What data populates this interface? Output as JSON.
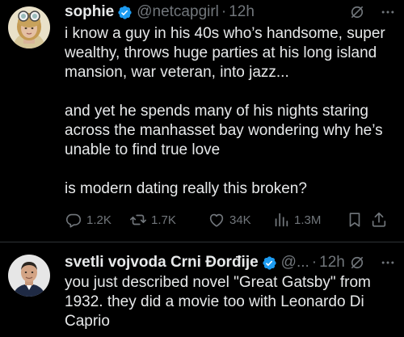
{
  "tweets": [
    {
      "display_name": "sophie",
      "handle": "@netcapgirl",
      "separator": "·",
      "time": "12h",
      "body": [
        "i know a guy in his 40s who’s handsome, super wealthy, throws huge parties at his long island mansion, war veteran, into jazz...",
        "and yet he spends many of his nights staring across the manhasset bay wondering why he’s unable to find true love",
        "is modern dating really this broken?"
      ],
      "stats": {
        "replies": "1.2K",
        "reposts": "1.7K",
        "likes": "34K",
        "views": "1.3M"
      }
    },
    {
      "display_name": "svetli vojvoda Crni Đorđije",
      "handle": "@...",
      "separator": "·",
      "time": "12h",
      "body": [
        "you just described novel \"Great Gatsby\" from 1932. they did a movie too with Leonardo Di Caprio"
      ]
    }
  ],
  "icons": {
    "verified": "verified-badge-icon",
    "grok": "grok-icon",
    "more": "more-icon",
    "reply": "reply-icon",
    "repost": "repost-icon",
    "like": "heart-icon",
    "views": "views-icon",
    "bookmark": "bookmark-icon",
    "share": "share-icon"
  },
  "colors": {
    "background": "#000000",
    "text": "#e7e9ea",
    "secondary": "#71767b",
    "verified": "#1d9bf0",
    "divider": "#2f3336"
  }
}
